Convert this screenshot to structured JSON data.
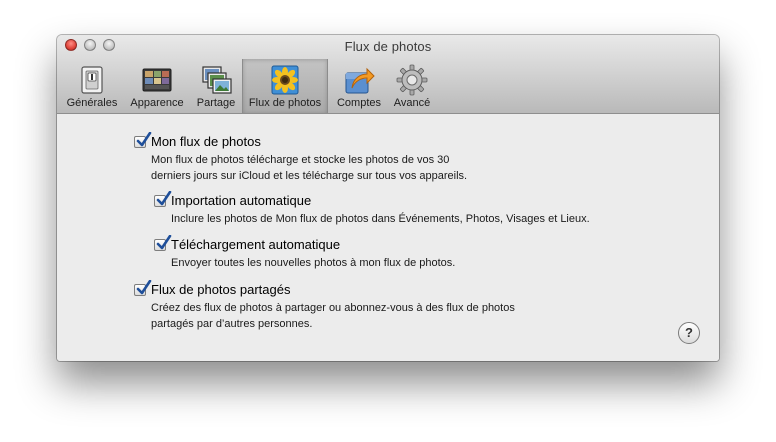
{
  "window": {
    "title": "Flux de photos"
  },
  "tabs": [
    {
      "label": "Générales",
      "icon": "switch-icon"
    },
    {
      "label": "Apparence",
      "icon": "appearance-icon"
    },
    {
      "label": "Partage",
      "icon": "sharing-icon"
    },
    {
      "label": "Flux de photos",
      "icon": "photo-stream-icon"
    },
    {
      "label": "Comptes",
      "icon": "accounts-icon"
    },
    {
      "label": "Avancé",
      "icon": "gear-icon"
    }
  ],
  "selected_tab": "Flux de photos",
  "options": {
    "photo_stream": {
      "label": "Mon flux de photos",
      "checked": true,
      "description": [
        "Mon flux de photos télécharge et stocke les photos de vos 30",
        "derniers jours sur iCloud et les télécharge sur tous vos appareils."
      ]
    },
    "auto_import": {
      "label": "Importation automatique",
      "checked": true,
      "description": "Inclure les photos de Mon flux de photos dans Événements, Photos, Visages et Lieux."
    },
    "auto_upload": {
      "label": "Téléchargement automatique",
      "checked": true,
      "description": "Envoyer toutes les nouvelles photos à mon flux de photos."
    },
    "shared_streams": {
      "label": "Flux de photos partagés",
      "checked": true,
      "description": [
        "Créez des flux de photos à partager ou abonnez-vous à des flux de photos",
        "partagés par d’autres personnes."
      ]
    }
  },
  "help": {
    "label": "?"
  },
  "colors": {
    "checkmark": "#1f4f9a",
    "close_button": "#e0443a"
  }
}
